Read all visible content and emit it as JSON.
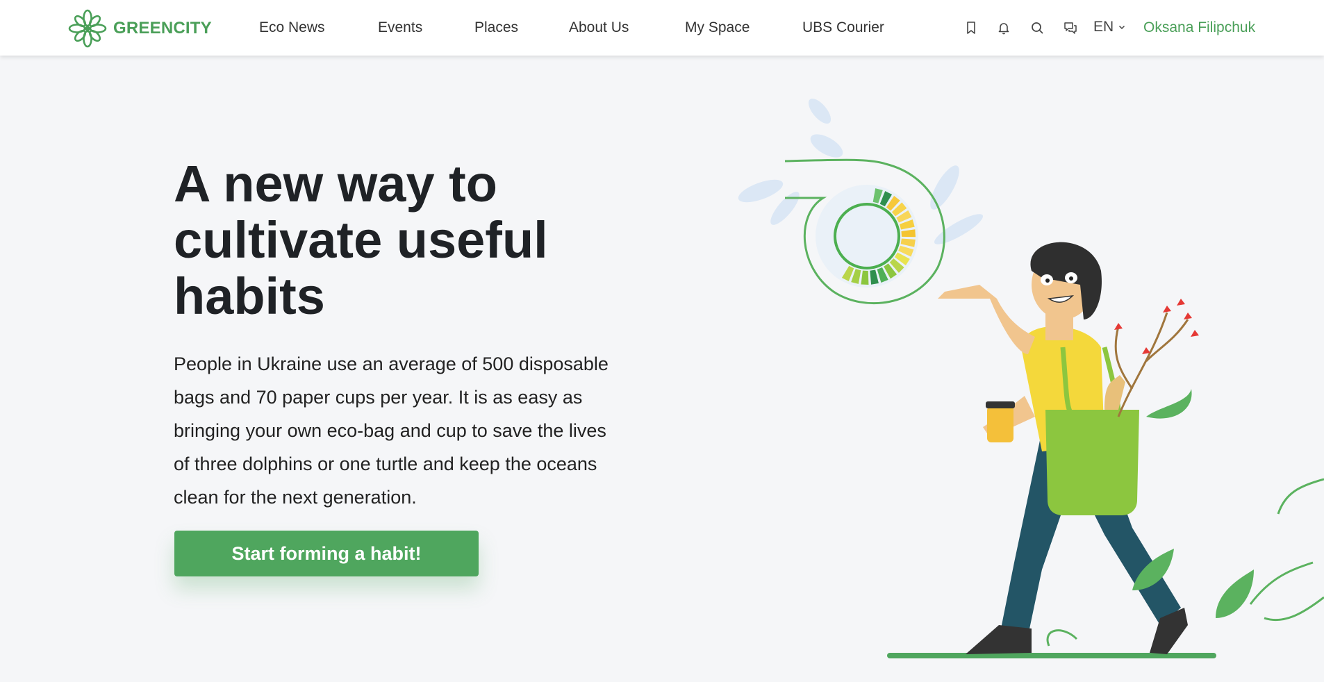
{
  "header": {
    "brand": "GREENCITY",
    "nav": [
      {
        "label": "Eco News"
      },
      {
        "label": "Events"
      },
      {
        "label": "Places"
      },
      {
        "label": "About Us"
      },
      {
        "label": "My Space"
      },
      {
        "label": "UBS Courier"
      }
    ],
    "icons": [
      "bookmark-icon",
      "bell-icon",
      "search-icon",
      "chat-icon"
    ],
    "language": "EN",
    "user_name": "Oksana Filipchuk"
  },
  "hero": {
    "title": "A new way to cultivate useful habits",
    "description": "People in Ukraine use an average of 500 disposable bags and 70 paper cups per year. It is as easy as bringing your own eco-bag and cup to save the lives of three dolphins or one turtle and keep the oceans clean for the next generation.",
    "cta_label": "Start forming a habit!"
  },
  "colors": {
    "brand_green": "#4fa65e",
    "text_dark": "#1f2226",
    "background": "#f5f6f8"
  }
}
